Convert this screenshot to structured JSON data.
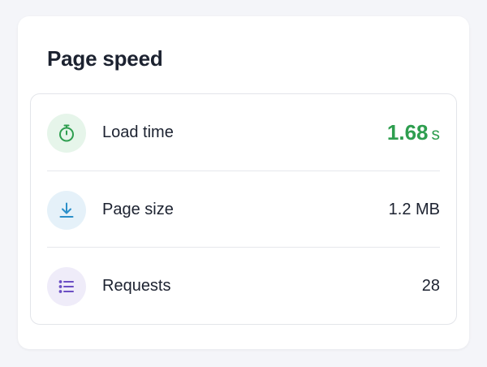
{
  "card": {
    "title": "Page speed"
  },
  "metrics": [
    {
      "label": "Load time",
      "value": "1.68",
      "unit": "s",
      "icon": "stopwatch-icon",
      "icon_color": "#2e9e4f",
      "icon_bg": "#e6f5ea",
      "value_color": "#2e9e4f"
    },
    {
      "label": "Page size",
      "value": "1.2 MB",
      "icon": "download-icon",
      "icon_color": "#2b8fc9",
      "icon_bg": "#e5f1f9"
    },
    {
      "label": "Requests",
      "value": "28",
      "icon": "list-icon",
      "icon_color": "#6b4fc4",
      "icon_bg": "#efecf9"
    }
  ]
}
